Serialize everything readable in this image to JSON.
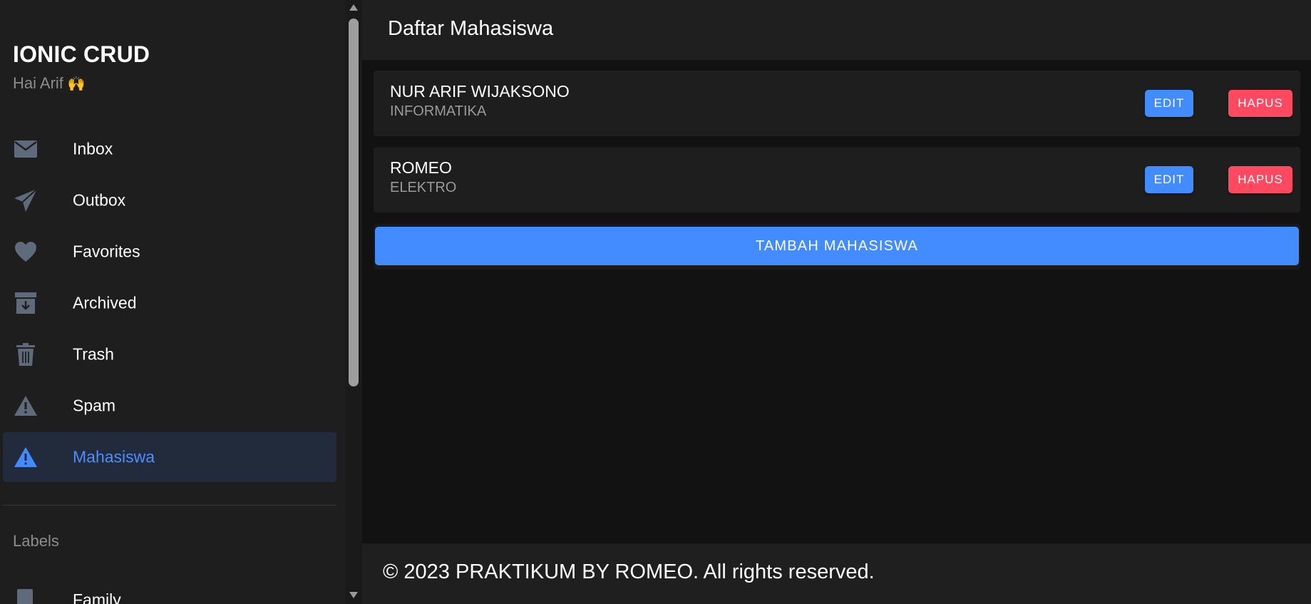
{
  "sidebar": {
    "title": "IONIC CRUD",
    "subtitle": "Hai Arif",
    "subtitle_emoji": "🙌",
    "items": [
      {
        "label": "Inbox",
        "icon": "mail-icon"
      },
      {
        "label": "Outbox",
        "icon": "paper-plane-icon"
      },
      {
        "label": "Favorites",
        "icon": "heart-icon"
      },
      {
        "label": "Archived",
        "icon": "archive-icon"
      },
      {
        "label": "Trash",
        "icon": "trash-icon"
      },
      {
        "label": "Spam",
        "icon": "warning-icon"
      },
      {
        "label": "Mahasiswa",
        "icon": "warning-icon",
        "active": true
      }
    ],
    "labels_heading": "Labels",
    "labels": [
      {
        "label": "Family",
        "icon": "bookmark-icon"
      }
    ]
  },
  "toolbar": {
    "title": "Daftar Mahasiswa"
  },
  "students": [
    {
      "name": "NUR ARIF WIJAKSONO",
      "major": "INFORMATIKA",
      "edit_label": "EDIT",
      "delete_label": "HAPUS"
    },
    {
      "name": "ROMEO",
      "major": "ELEKTRO",
      "edit_label": "EDIT",
      "delete_label": "HAPUS"
    }
  ],
  "add_button_label": "TAMBAH MAHASISWA",
  "footer": {
    "text": "© 2023 PRAKTIKUM BY ROMEO. All rights reserved."
  },
  "colors": {
    "primary": "#428cff",
    "danger": "#ff4961",
    "icon_muted": "#5f6b7b",
    "active_bg": "#212b3c"
  }
}
